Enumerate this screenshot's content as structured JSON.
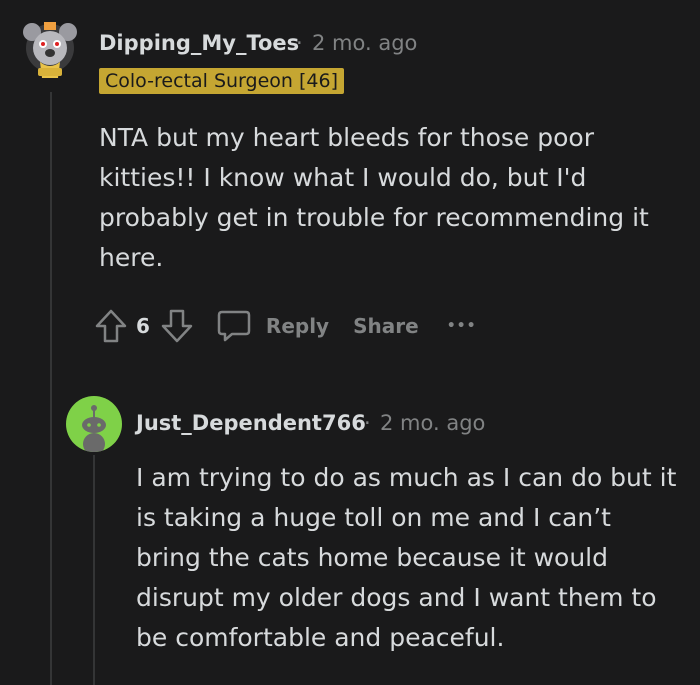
{
  "comment": {
    "username": "Dipping_My_Toes",
    "separator": "·",
    "time": "2 mo. ago",
    "flair": "Colo-rectal Surgeon [46]",
    "body": "NTA but my heart bleeds for those poor kitties!! I know what I would do, but I'd probably get in trouble for recommending it here.",
    "actions": {
      "vote_count": "6",
      "reply_label": "Reply",
      "share_label": "Share",
      "more_label": "•••"
    }
  },
  "reply": {
    "username": "Just_Dependent766",
    "separator": "·",
    "time": "2 mo. ago",
    "body": "I am trying to do as much as I can do but it is taking a huge toll on me and I can’t bring the cats home because it would disrupt my older dogs and I want them to be comfortable and peaceful."
  },
  "colors": {
    "background": "#1a1a1b",
    "text": "#d7dadc",
    "meta": "#818384",
    "flair_bg": "#c5a632",
    "reply_avatar_bg": "#7fd148"
  }
}
